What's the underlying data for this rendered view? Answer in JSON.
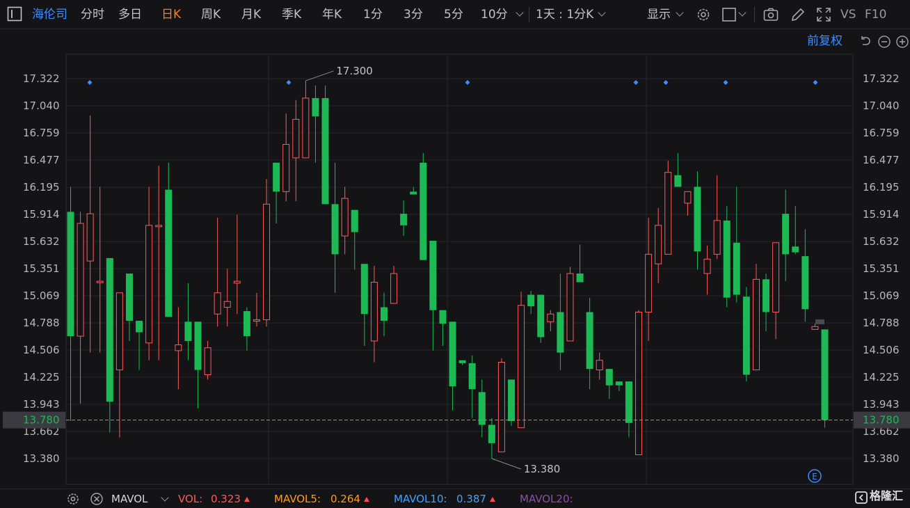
{
  "toolbar": {
    "stock_name": "海伦司",
    "periods": [
      "分时",
      "多日",
      "日K",
      "周K",
      "月K",
      "季K",
      "年K",
      "1分",
      "3分",
      "5分",
      "10分"
    ],
    "active_period": "日K",
    "interval_select": "1天 : 1分K",
    "display_label": "显示",
    "vs_label": "VS",
    "f10_label": "F10"
  },
  "adjust_label": "前复权",
  "indicator_bar": {
    "name": "MAVOL",
    "items": [
      {
        "label": "VOL:",
        "value": "0.323",
        "color": "#ff5a5a"
      },
      {
        "label": "MAVOL5:",
        "value": "0.264",
        "color": "#ff9a1f"
      },
      {
        "label": "MAVOL10:",
        "value": "0.387",
        "color": "#3fa3ff"
      },
      {
        "label": "MAVOL20:",
        "value": "",
        "color": "#8a4fa8"
      }
    ]
  },
  "logo_text": "格隆汇",
  "event_marker": "E",
  "chart_data": {
    "type": "candlestick",
    "y_ticks": [
      "17.322",
      "17.040",
      "16.759",
      "16.477",
      "16.195",
      "15.914",
      "15.632",
      "15.351",
      "15.069",
      "14.788",
      "14.506",
      "14.225",
      "13.943",
      "13.662",
      "13.380"
    ],
    "ylim": [
      13.1,
      17.6
    ],
    "last_price": "13.780",
    "high_label": "17.300",
    "low_label": "13.380",
    "colors": {
      "up": "#ff5a5a",
      "down": "#1db954",
      "last": "#e8794a"
    },
    "candles": [
      [
        15.94,
        14.65,
        16.2,
        13.77
      ],
      [
        14.65,
        15.82,
        15.94,
        13.95
      ],
      [
        15.43,
        15.92,
        16.94,
        14.48
      ],
      [
        15.22,
        15.22,
        16.2,
        14.48
      ],
      [
        15.46,
        13.97,
        15.46,
        13.65
      ],
      [
        14.3,
        15.1,
        15.1,
        13.6
      ],
      [
        15.3,
        14.81,
        15.3,
        14.6
      ],
      [
        14.81,
        14.69,
        14.81,
        14.3
      ],
      [
        14.58,
        15.8,
        16.2,
        14.4
      ],
      [
        15.8,
        15.8,
        16.42,
        14.4
      ],
      [
        16.17,
        14.85,
        16.45,
        14.85
      ],
      [
        14.5,
        14.56,
        14.95,
        14.1
      ],
      [
        14.8,
        14.6,
        15.2,
        14.4
      ],
      [
        14.8,
        14.3,
        14.8,
        13.9
      ],
      [
        14.25,
        14.53,
        14.6,
        14.2
      ],
      [
        14.88,
        15.1,
        15.88,
        14.75
      ],
      [
        14.95,
        15.01,
        15.35,
        14.75
      ],
      [
        15.2,
        15.22,
        15.91,
        14.88
      ],
      [
        14.91,
        14.65,
        14.95,
        14.5
      ],
      [
        14.82,
        14.82,
        15.1,
        14.75
      ],
      [
        14.82,
        16.02,
        16.28,
        14.75
      ],
      [
        16.45,
        16.15,
        16.45,
        15.82
      ],
      [
        16.15,
        16.64,
        16.96,
        16.05
      ],
      [
        16.5,
        16.9,
        17.1,
        16.05
      ],
      [
        16.5,
        17.12,
        17.3,
        16.5
      ],
      [
        17.12,
        16.93,
        17.25,
        16.45
      ],
      [
        17.12,
        16.02,
        17.25,
        16.02
      ],
      [
        16.02,
        15.5,
        16.45,
        15.1
      ],
      [
        15.69,
        16.08,
        16.2,
        15.5
      ],
      [
        15.96,
        15.73,
        15.96,
        15.34
      ],
      [
        15.4,
        14.88,
        15.4,
        14.55
      ],
      [
        14.6,
        15.21,
        15.38,
        14.38
      ],
      [
        14.95,
        14.81,
        15.1,
        14.65
      ],
      [
        14.99,
        15.3,
        15.38,
        14.99
      ],
      [
        15.92,
        15.8,
        16.06,
        15.69
      ],
      [
        16.15,
        16.12,
        16.2,
        16.15
      ],
      [
        16.45,
        15.44,
        16.55,
        15.44
      ],
      [
        15.64,
        14.92,
        15.64,
        14.5
      ],
      [
        14.92,
        14.78,
        14.92,
        14.55
      ],
      [
        14.8,
        14.13,
        14.8,
        13.88
      ],
      [
        14.4,
        14.37,
        14.4,
        14.35
      ],
      [
        14.37,
        14.1,
        14.45,
        13.8
      ],
      [
        14.07,
        13.73,
        14.2,
        13.6
      ],
      [
        13.73,
        13.54,
        13.8,
        13.38
      ],
      [
        13.45,
        14.38,
        14.42,
        13.45
      ],
      [
        14.2,
        13.77,
        14.2,
        13.72
      ],
      [
        13.7,
        14.97,
        15.11,
        13.7
      ],
      [
        15.08,
        14.96,
        15.12,
        14.88
      ],
      [
        15.08,
        14.64,
        15.08,
        14.58
      ],
      [
        14.8,
        14.88,
        14.92,
        14.7
      ],
      [
        14.9,
        14.48,
        15.3,
        14.3
      ],
      [
        14.6,
        15.3,
        15.37,
        14.6
      ],
      [
        15.3,
        15.21,
        15.6,
        15.21
      ],
      [
        14.9,
        14.31,
        15.05,
        14.1
      ],
      [
        14.3,
        14.4,
        14.48,
        14.2
      ],
      [
        14.31,
        14.14,
        14.31,
        14.0
      ],
      [
        14.18,
        14.14,
        14.18,
        14.08
      ],
      [
        14.18,
        13.75,
        14.18,
        13.6
      ],
      [
        13.42,
        14.9,
        14.92,
        13.42
      ],
      [
        14.9,
        15.5,
        15.88,
        14.6
      ],
      [
        15.4,
        15.8,
        15.98,
        15.2
      ],
      [
        15.5,
        16.35,
        16.47,
        15.5
      ],
      [
        16.32,
        16.2,
        16.55,
        16.2
      ],
      [
        16.03,
        16.15,
        16.15,
        15.9
      ],
      [
        16.2,
        15.53,
        16.36,
        15.34
      ],
      [
        15.3,
        15.45,
        15.59,
        15.08
      ],
      [
        15.5,
        15.85,
        16.32,
        15.45
      ],
      [
        15.85,
        15.05,
        16.0,
        14.95
      ],
      [
        15.62,
        15.08,
        16.2,
        15.0
      ],
      [
        15.06,
        14.25,
        15.16,
        14.18
      ],
      [
        14.3,
        15.24,
        15.4,
        14.3
      ],
      [
        15.24,
        14.9,
        15.3,
        14.7
      ],
      [
        14.9,
        15.62,
        15.62,
        14.62
      ],
      [
        15.92,
        15.5,
        16.17,
        15.22
      ],
      [
        15.58,
        15.52,
        16.0,
        15.5
      ],
      [
        15.48,
        14.93,
        15.76,
        14.8
      ],
      [
        14.72,
        14.75,
        14.78,
        14.72
      ],
      [
        14.72,
        13.78,
        14.72,
        13.7
      ]
    ]
  }
}
